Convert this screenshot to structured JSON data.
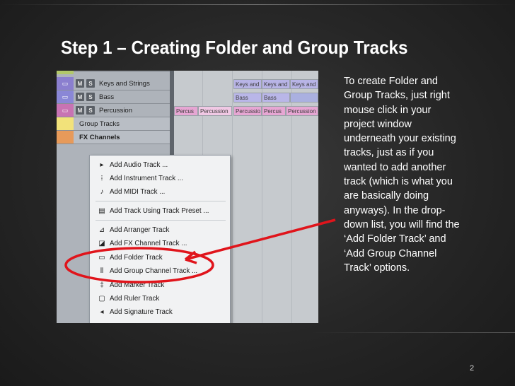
{
  "slide": {
    "title": "Step 1 – Creating Folder and Group Tracks",
    "body": "To create Folder and Group Tracks, just right mouse click in your project window underneath your existing tracks, just as if you wanted to add another track (which is what you are basically doing anyways). In the drop-down list, you will find the ‘Add Folder Track’ and ‘Add Group Channel Track’ options.",
    "page_number": "2"
  },
  "screenshot": {
    "tracks": [
      {
        "name": "Keys and Strings",
        "color": "#8b7fcf",
        "m": "M",
        "s": "S"
      },
      {
        "name": "Bass",
        "color": "#8a87d6",
        "m": "M",
        "s": "S"
      },
      {
        "name": "Percussion",
        "color": "#c873b3",
        "m": "M",
        "s": "S"
      },
      {
        "name": "Group Tracks",
        "color": "#f2e27a"
      },
      {
        "name": "FX Channels",
        "color": "#e79a5a"
      }
    ],
    "clips": {
      "keys": [
        "Keys and",
        "Keys and",
        "Keys and"
      ],
      "bass": [
        "Bass",
        "Bass"
      ],
      "percussion": [
        "Percus",
        "Percussion",
        "Percussio",
        "Percus",
        "Percussion",
        "Percussio"
      ]
    },
    "context_menu": [
      {
        "label": "Add Audio Track ...",
        "icon": "audio-track-icon",
        "glyph": "▸"
      },
      {
        "label": "Add Instrument Track ...",
        "icon": "instrument-track-icon",
        "glyph": "⦙"
      },
      {
        "label": "Add MIDI Track ...",
        "icon": "midi-track-icon",
        "glyph": "♪"
      },
      {
        "label": "Add Track Using Track Preset ...",
        "icon": "track-preset-icon",
        "glyph": "▤"
      },
      {
        "label": "Add Arranger Track",
        "icon": "arranger-track-icon",
        "glyph": "⊿"
      },
      {
        "label": "Add FX Channel Track ...",
        "icon": "fx-channel-icon",
        "glyph": "◪"
      },
      {
        "label": "Add Folder Track",
        "icon": "folder-track-icon",
        "glyph": "▭"
      },
      {
        "label": "Add Group Channel Track ...",
        "icon": "group-channel-icon",
        "glyph": "⫴"
      },
      {
        "label": "Add Marker Track",
        "icon": "marker-track-icon",
        "glyph": "‡"
      },
      {
        "label": "Add Ruler Track",
        "icon": "ruler-track-icon",
        "glyph": "▢"
      },
      {
        "label": "Add Signature Track",
        "icon": "signature-track-icon",
        "glyph": "◂"
      }
    ]
  },
  "colors": {
    "annotation_red": "#e0141b",
    "clip_keys": "#b8b4e6",
    "clip_bass": "#b9b6e8",
    "clip_percussion": "#e6a6d3"
  }
}
